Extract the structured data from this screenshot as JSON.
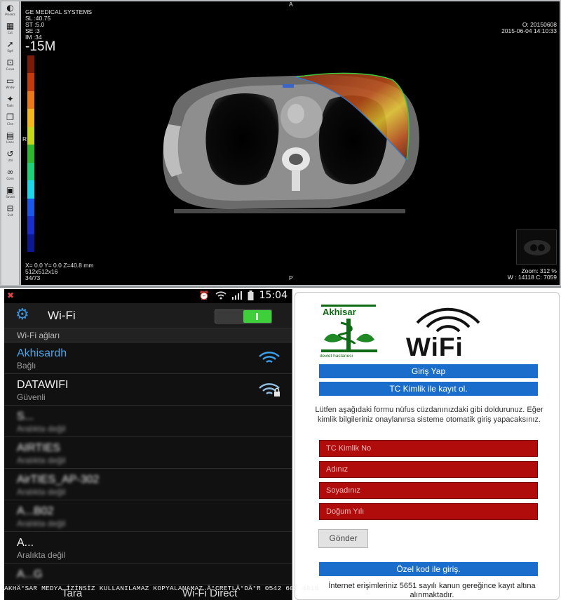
{
  "ct_viewer": {
    "toolbar": [
      {
        "icon": "contrast-icon",
        "glyph": "◐",
        "label": "Presets"
      },
      {
        "icon": "grid-icon",
        "glyph": "▦",
        "label": "Cut"
      },
      {
        "icon": "arrow-icon",
        "glyph": "➚",
        "label": "Sgrf"
      },
      {
        "icon": "box-icon",
        "glyph": "⊡",
        "label": "Curve"
      },
      {
        "icon": "window-icon",
        "glyph": "▭",
        "label": "Wndw"
      },
      {
        "icon": "tools-icon",
        "glyph": "✦",
        "label": "Tools"
      },
      {
        "icon": "layers-icon",
        "glyph": "❐",
        "label": "Cine"
      },
      {
        "icon": "stack-icon",
        "glyph": "▤",
        "label": "Lines"
      },
      {
        "icon": "reset-icon",
        "glyph": "↺",
        "label": "Util"
      },
      {
        "icon": "link-icon",
        "glyph": "∞",
        "label": "Conn"
      },
      {
        "icon": "report-icon",
        "glyph": "▣",
        "label": "Saved"
      },
      {
        "icon": "exit-icon",
        "glyph": "⊟",
        "label": "Exit"
      }
    ],
    "header_lines": [
      "GE MEDICAL SYSTEMS",
      "SL :40.75",
      "ST :5.0",
      "SE :3",
      "IM :34"
    ],
    "window_level": "-15M",
    "top_marker": "A",
    "bottom_marker": "P",
    "left_marker": "R",
    "date_top": "O: 20150608",
    "datetime": "2015-06-04 14:10:33",
    "coords": "X= 0.0 Y= 0.0 Z=40.8 mm",
    "matrix": "512x512x16",
    "image_index": "34/73",
    "zoom": "Zoom: 312 %",
    "window": "W : 14118 C: 7059",
    "colorbar_colors": [
      "#7a1a08",
      "#c23a10",
      "#e87a1a",
      "#f0b81a",
      "#c6d71a",
      "#2fb82f",
      "#1fd07a",
      "#1fd6e8",
      "#1a58e8",
      "#1a2ec8",
      "#0c1890"
    ]
  },
  "phone": {
    "status_time": "15:04",
    "title": "Wi-Fi",
    "toggle_on": true,
    "section_title": "Wi-Fi ağları",
    "networks": [
      {
        "name": "Akhisardh",
        "status": "Bağlı",
        "active": true,
        "locked": false,
        "obscured": false
      },
      {
        "name": "DATAWIFI",
        "status": "Güvenli",
        "active": false,
        "locked": true,
        "obscured": false
      },
      {
        "name": "S...",
        "status": "Aralıkta değil",
        "active": false,
        "locked": false,
        "obscured": true
      },
      {
        "name": "AIRTIES",
        "status": "Aralıkta değil",
        "active": false,
        "locked": false,
        "obscured": true
      },
      {
        "name": "AirTIES_AP-302",
        "status": "Aralıkta değil",
        "active": false,
        "locked": false,
        "obscured": true
      },
      {
        "name": "A...B02",
        "status": "Aralıkta değil",
        "active": false,
        "locked": false,
        "obscured": true
      },
      {
        "name": "A...",
        "status": "Aralıkta değil",
        "active": false,
        "locked": false,
        "obscured": false
      },
      {
        "name": "A...G",
        "status": "",
        "active": false,
        "locked": false,
        "obscured": true
      }
    ],
    "bottom_left": "Tara",
    "bottom_right": "Wi-Fi Direct"
  },
  "portal": {
    "logo_name": "Akhisar",
    "logo_subtitle": "devlet hastanesi",
    "wifi_logo_text": "WiFi",
    "login_button": "Giriş Yap",
    "register_button": "TC Kimlik ile kayıt ol.",
    "info_text": "Lütfen aşağıdaki formu nüfus cüzdanınızdaki gibi doldurunuz. Eğer kimlik bilgileriniz onaylanırsa sisteme otomatik giriş yapacaksınız.",
    "fields": [
      "TC Kimlik No",
      "Adınız",
      "Soyadınız",
      "Doğum Yılı"
    ],
    "submit_button": "Gönder",
    "special_code_button": "Özel kod ile giriş.",
    "legal_text": "İnternet erişimleriniz 5651 sayılı kanun gereğince kayıt altına alınmaktadır."
  },
  "watermark": "AKHÄ°SAR MEDYA İZİNSİZ KULLANILAMAZ KOPYALANAMAZ Ä°CRETLÄ°DÄ°R  0542 602 4818"
}
